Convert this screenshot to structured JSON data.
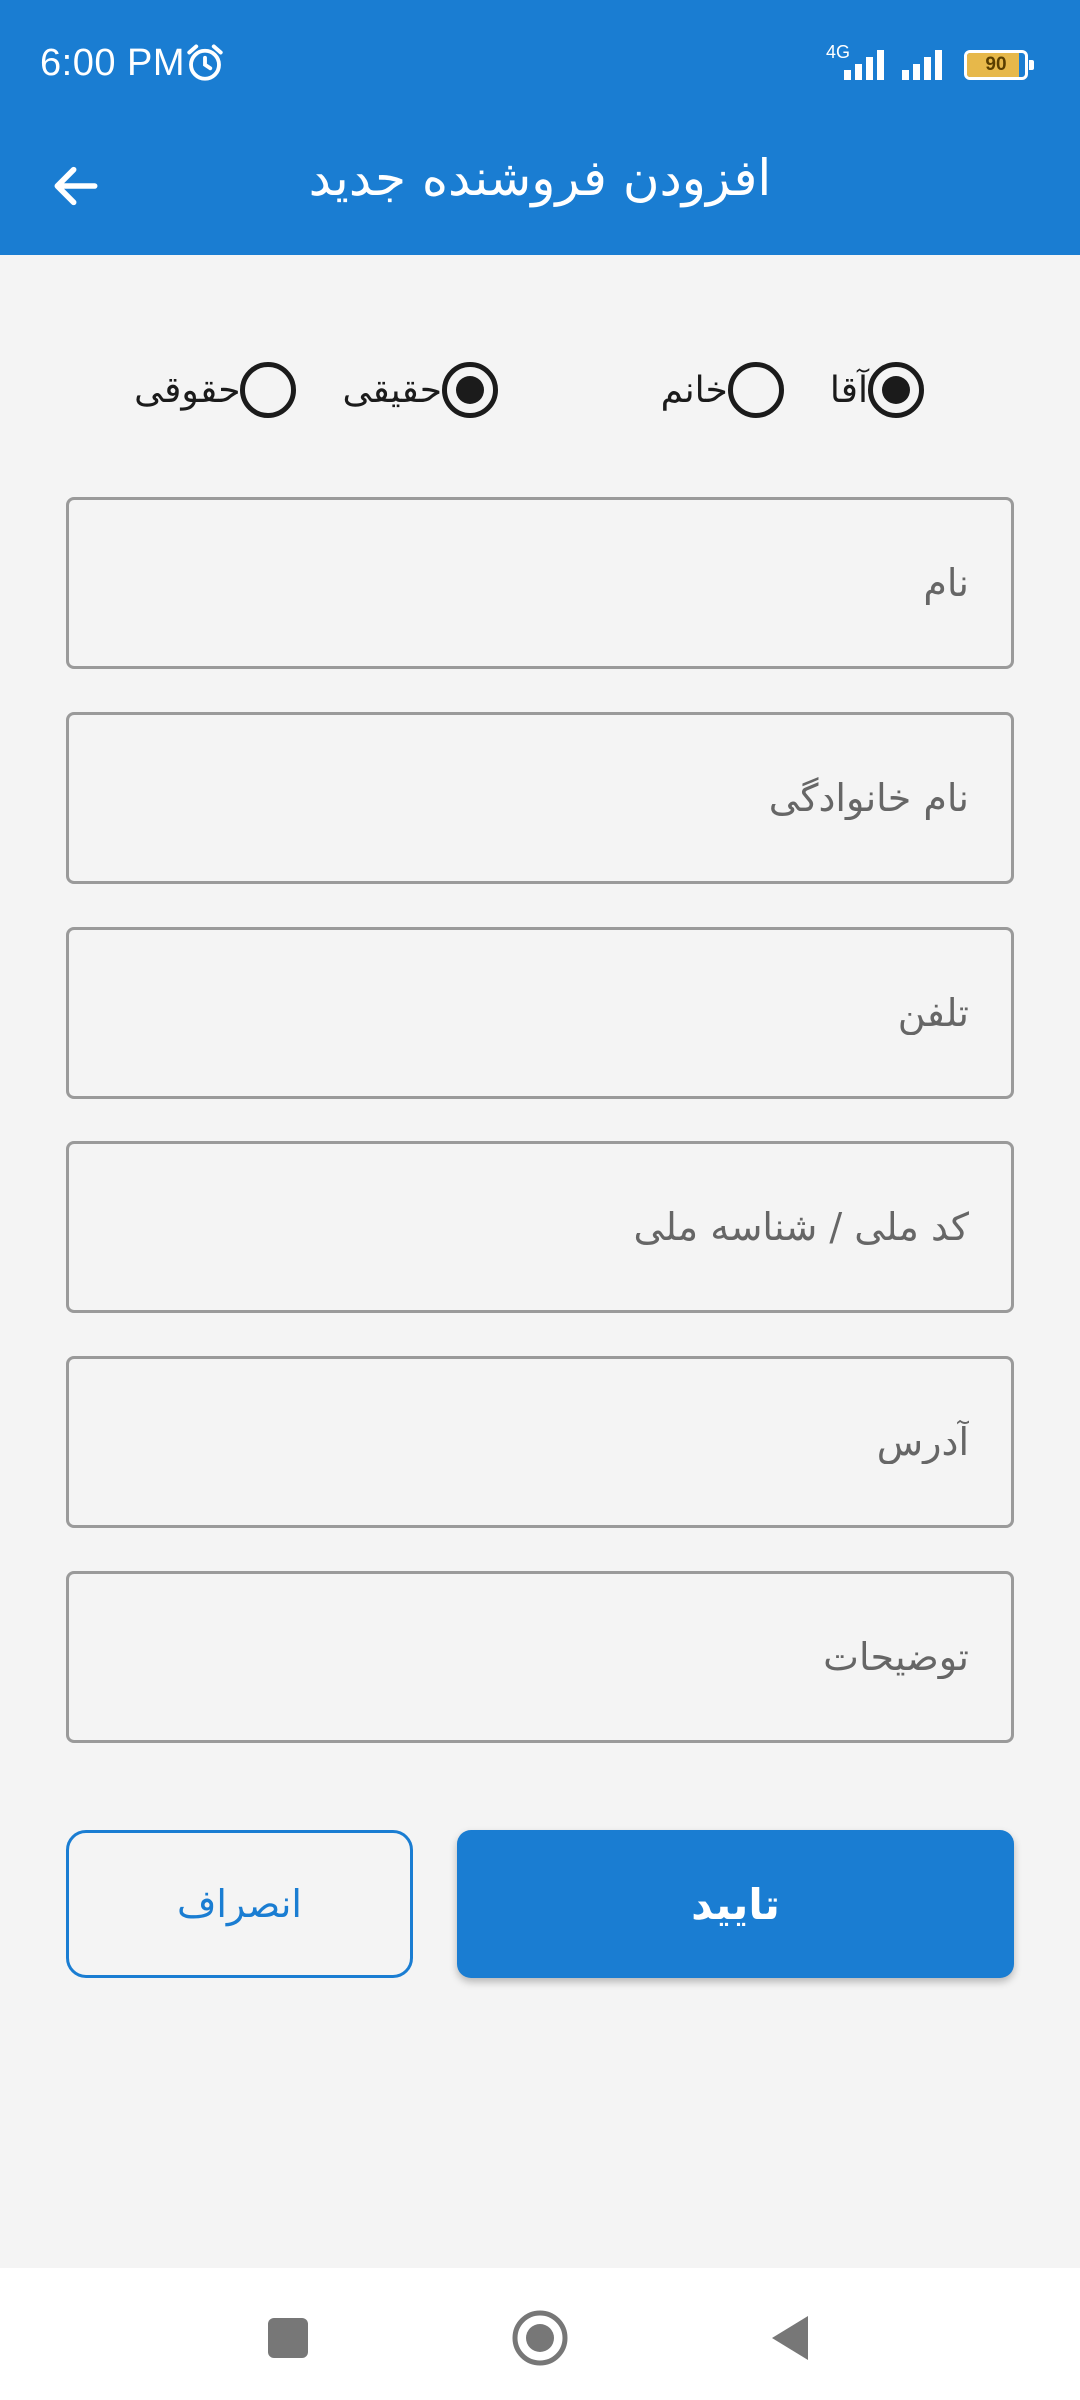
{
  "status_bar": {
    "time": "6:00 PM",
    "network": "4G",
    "battery_level": 90,
    "battery_text": "90",
    "icons": [
      "alarm-icon",
      "signal-icon",
      "signal-icon",
      "battery-icon"
    ]
  },
  "app_bar": {
    "title": "افزودن فروشنده جدید",
    "back_icon": "arrow-left-icon"
  },
  "gender": {
    "options": [
      {
        "label": "آقا",
        "checked": true
      },
      {
        "label": "خانم",
        "checked": false
      }
    ]
  },
  "person_type": {
    "options": [
      {
        "label": "حقیقی",
        "checked": true
      },
      {
        "label": "حقوقی",
        "checked": false
      }
    ]
  },
  "fields": {
    "first_name": {
      "placeholder": "نام",
      "value": ""
    },
    "last_name": {
      "placeholder": "نام خانوادگی",
      "value": ""
    },
    "phone": {
      "placeholder": "تلفن",
      "value": ""
    },
    "national_id": {
      "placeholder": "کد ملی / شناسه ملی",
      "value": ""
    },
    "address": {
      "placeholder": "آدرس",
      "value": ""
    },
    "notes": {
      "placeholder": "توضیحات",
      "value": ""
    }
  },
  "buttons": {
    "confirm": "تایید",
    "cancel": "انصراف"
  },
  "colors": {
    "primary": "#1a7dd2",
    "background": "#f4f4f4",
    "field_border": "#9a9a9a",
    "battery": "#e7b84a"
  },
  "nav_bar": {
    "icons": [
      "recents-square-icon",
      "home-circle-icon",
      "back-triangle-icon"
    ]
  }
}
